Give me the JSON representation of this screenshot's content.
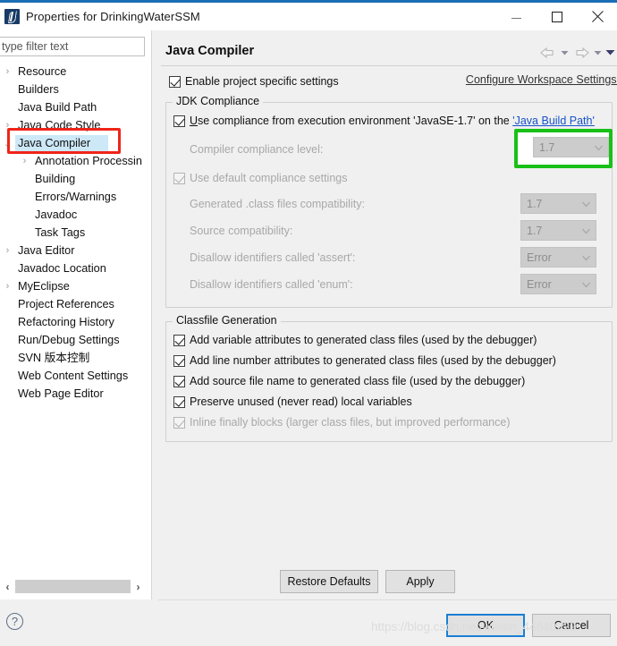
{
  "window": {
    "title": "Properties for DrinkingWaterSSM",
    "app_icon": "myeclipse-icon",
    "minimize": "minimize-icon",
    "maximize": "maximize-icon",
    "close": "close-icon"
  },
  "sidebar": {
    "filter_placeholder": "type filter text",
    "filter_value": "type filter text",
    "items": [
      {
        "label": "Resource",
        "twisty": "›",
        "indent": 0,
        "selected": false
      },
      {
        "label": "Builders",
        "twisty": "",
        "indent": 0,
        "selected": false
      },
      {
        "label": "Java Build Path",
        "twisty": "",
        "indent": 0,
        "selected": false
      },
      {
        "label": "Java Code Style",
        "twisty": "›",
        "indent": 0,
        "selected": false
      },
      {
        "label": "Java Compiler",
        "twisty": "⌄",
        "indent": 0,
        "selected": true
      },
      {
        "label": "Annotation Processin",
        "twisty": "›",
        "indent": 1,
        "selected": false
      },
      {
        "label": "Building",
        "twisty": "",
        "indent": 1,
        "selected": false
      },
      {
        "label": "Errors/Warnings",
        "twisty": "",
        "indent": 1,
        "selected": false
      },
      {
        "label": "Javadoc",
        "twisty": "",
        "indent": 1,
        "selected": false
      },
      {
        "label": "Task Tags",
        "twisty": "",
        "indent": 1,
        "selected": false
      },
      {
        "label": "Java Editor",
        "twisty": "›",
        "indent": 0,
        "selected": false
      },
      {
        "label": "Javadoc Location",
        "twisty": "",
        "indent": 0,
        "selected": false
      },
      {
        "label": "MyEclipse",
        "twisty": "›",
        "indent": 0,
        "selected": false
      },
      {
        "label": "Project References",
        "twisty": "",
        "indent": 0,
        "selected": false
      },
      {
        "label": "Refactoring History",
        "twisty": "",
        "indent": 0,
        "selected": false
      },
      {
        "label": "Run/Debug Settings",
        "twisty": "",
        "indent": 0,
        "selected": false
      },
      {
        "label": "SVN 版本控制",
        "twisty": "",
        "indent": 0,
        "selected": false
      },
      {
        "label": "Web Content Settings",
        "twisty": "",
        "indent": 0,
        "selected": false
      },
      {
        "label": "Web Page Editor",
        "twisty": "",
        "indent": 0,
        "selected": false
      }
    ],
    "scroll_left_arrow": "‹",
    "scroll_right_arrow": "›"
  },
  "page": {
    "title": "Java Compiler",
    "nav_back": "back-arrow-icon",
    "nav_back_menu": "chevron-down-icon",
    "nav_forward": "forward-arrow-icon",
    "nav_forward_menu": "chevron-down-icon",
    "view_menu": "chevron-down-icon",
    "enable_project_settings": {
      "label": "Enable project specific settings",
      "checked": true
    },
    "configure_workspace_link": "Configure Workspace Settings."
  },
  "jdk_compliance": {
    "legend": "JDK Compliance",
    "use_execution_env": {
      "label_prefix": "U",
      "label_rest": "se compliance from execution environment 'JavaSE-1.7' on the ",
      "link": "'Java Build Path'",
      "checked": true
    },
    "rows": [
      {
        "label": "Compiler compliance level:",
        "value": "1.7",
        "disabled": true
      },
      {
        "label": "Generated .class files compatibility:",
        "value": "1.7",
        "disabled": true
      },
      {
        "label": "Source compatibility:",
        "value": "1.7",
        "disabled": true
      },
      {
        "label": "Disallow identifiers called 'assert':",
        "value": "Error",
        "disabled": true
      },
      {
        "label": "Disallow identifiers called 'enum':",
        "value": "Error",
        "disabled": true
      }
    ],
    "use_default_compliance": {
      "label": "Use default compliance settings",
      "checked": true,
      "disabled": true
    }
  },
  "classfile_generation": {
    "legend": "Classfile Generation",
    "options": [
      {
        "label": "Add variable attributes to generated class files (used by the debugger)",
        "checked": true,
        "disabled": false
      },
      {
        "label": "Add line number attributes to generated class files (used by the debugger)",
        "checked": true,
        "disabled": false
      },
      {
        "label": "Add source file name to generated class file (used by the debugger)",
        "checked": true,
        "disabled": false
      },
      {
        "label": "Preserve unused (never read) local variables",
        "checked": true,
        "disabled": false
      },
      {
        "label": "Inline finally blocks (larger class files, but improved performance)",
        "checked": true,
        "disabled": true
      }
    ]
  },
  "buttons": {
    "restore_defaults": "Restore Defaults",
    "apply": "Apply",
    "ok": "OK",
    "cancel": "Cancel",
    "help": "?"
  },
  "annotations": {
    "red_box_target": "Java Compiler",
    "red_box_color": "#ef2419",
    "green_box_target": "Compiler compliance level combo",
    "green_box_color": "#19c017"
  },
  "watermark": "https://blog.csdn.net/weixin_44640229"
}
